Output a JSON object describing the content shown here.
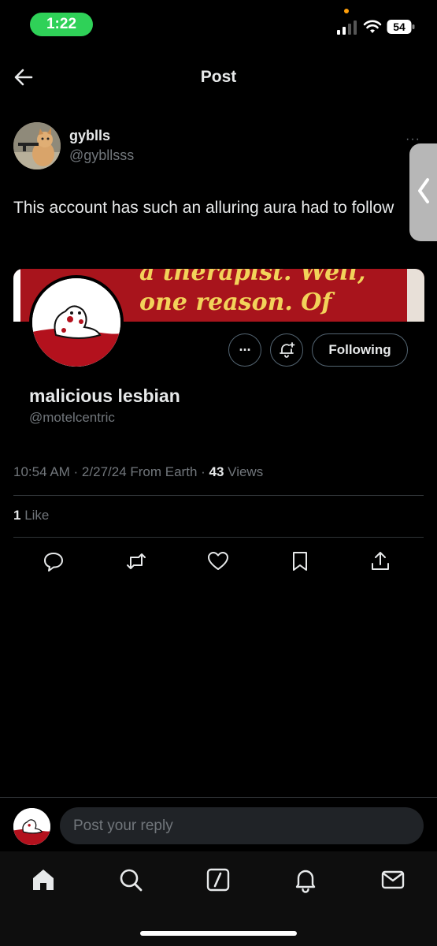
{
  "status_bar": {
    "time": "1:22",
    "battery": "54"
  },
  "header": {
    "title": "Post"
  },
  "tweet": {
    "author_name": "gyblls",
    "author_handle": "@gybllsss",
    "text": "This account has such an alluring aura had to follow",
    "timestamp": "10:54 AM · 2/27/24 From Earth · ",
    "views_count": "43",
    "views_label": " Views",
    "likes_count": "1",
    "likes_label": " Like"
  },
  "embedded_profile": {
    "banner_text": "a therapist. Well, one reason. Of many.",
    "name": "malicious lesbian",
    "handle": "@motelcentric",
    "follow_state": "Following",
    "more_label": "···"
  },
  "reply": {
    "placeholder": "Post your reply"
  },
  "colors": {
    "accent_green": "#2fd158",
    "muted": "#71767b",
    "banner_red": "#a8141c",
    "banner_text": "#f2d35a"
  },
  "icons": {
    "actions": [
      "reply-icon",
      "repost-icon",
      "like-icon",
      "bookmark-icon",
      "share-icon"
    ],
    "tabs": [
      "home-icon",
      "search-icon",
      "grok-icon",
      "notifications-icon",
      "messages-icon"
    ]
  }
}
